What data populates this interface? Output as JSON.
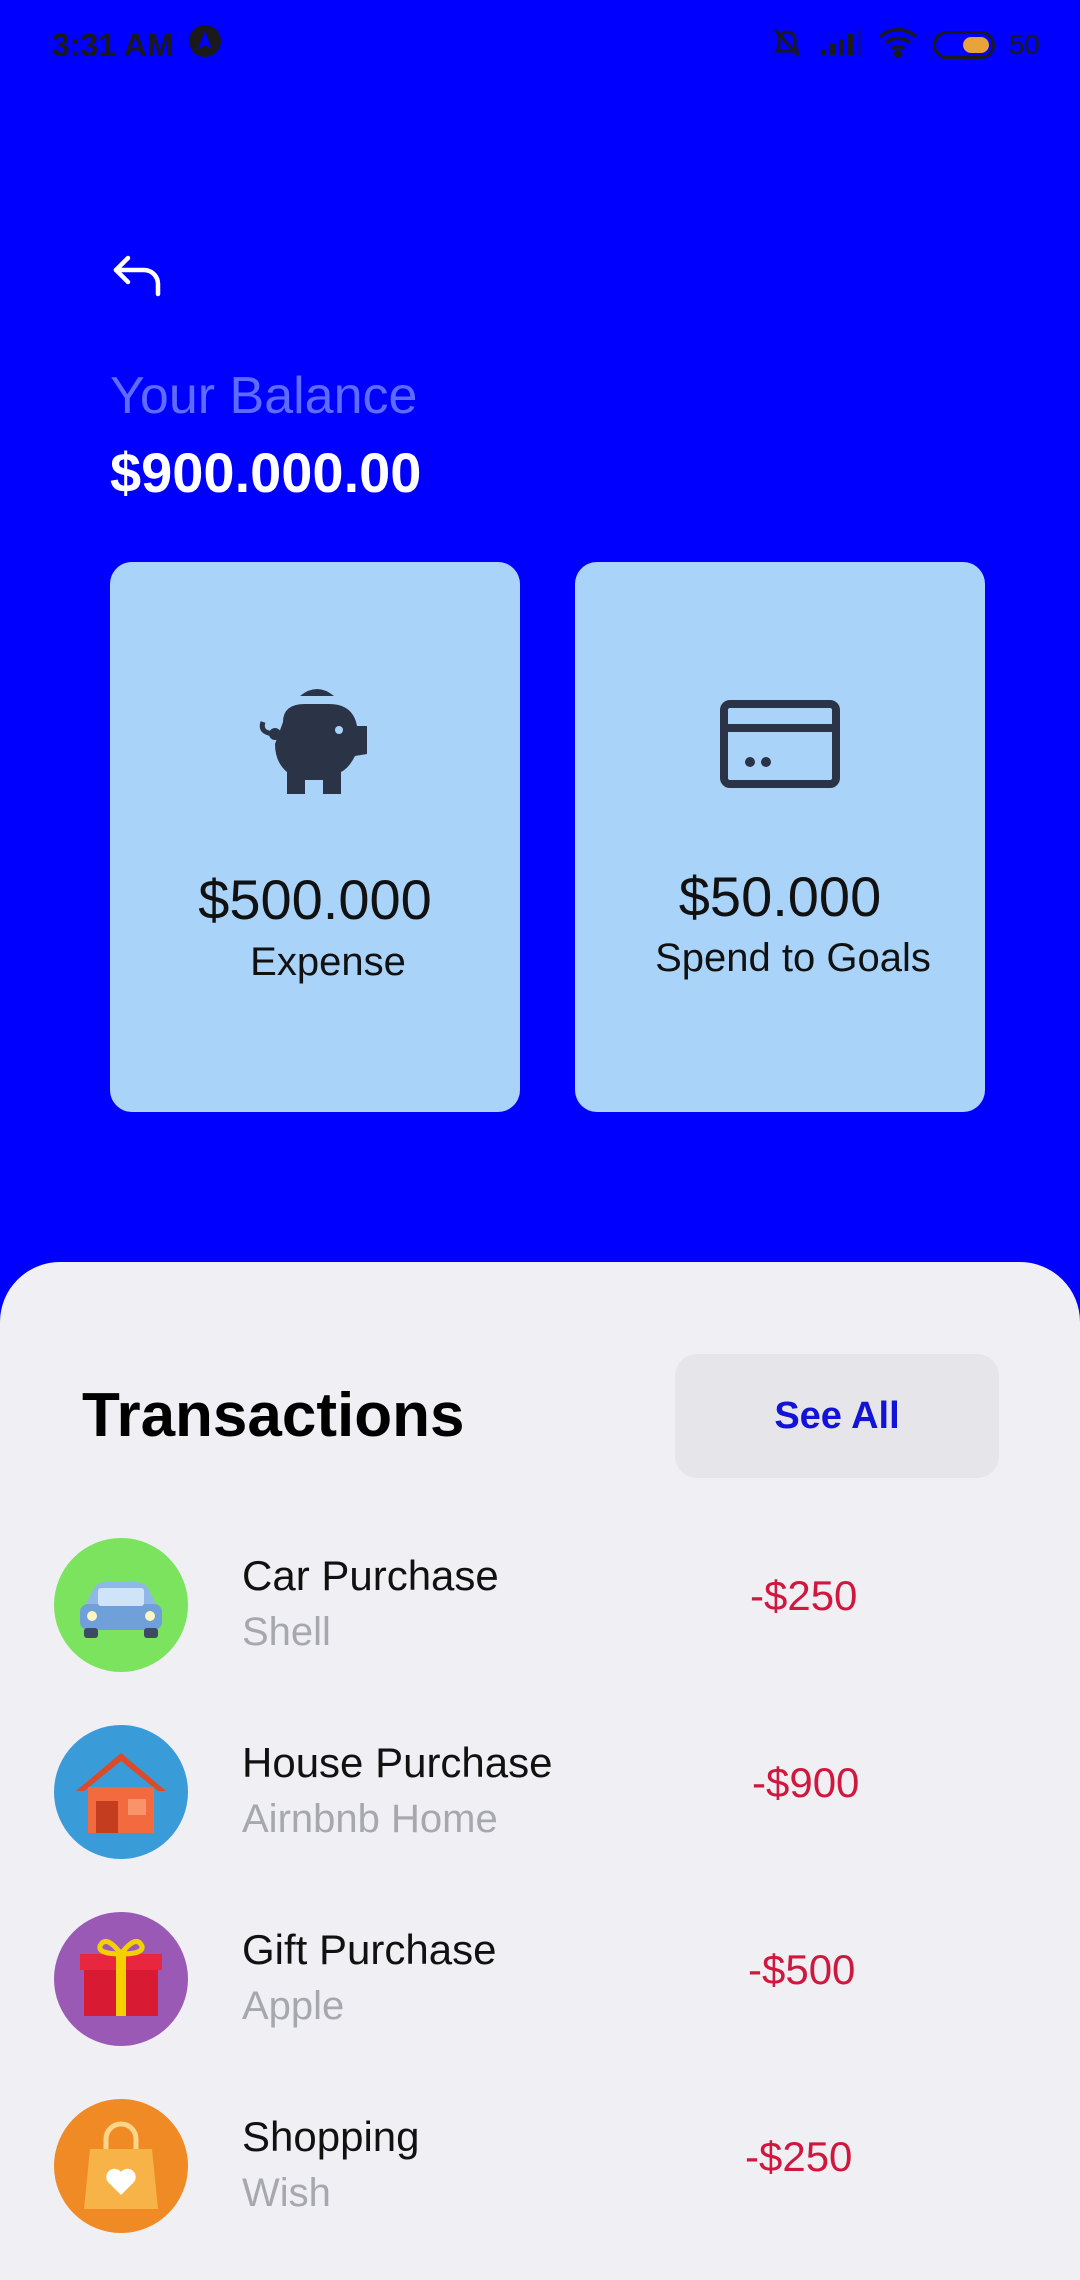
{
  "status_bar": {
    "time": "3:31 AM",
    "battery": "50"
  },
  "header": {
    "balance_label": "Your Balance",
    "balance_value": "$900.000.00"
  },
  "cards": [
    {
      "icon": "piggy-bank-icon",
      "amount": "$500.000",
      "label": "Expense"
    },
    {
      "icon": "credit-card-icon",
      "amount": "$50.000",
      "label": "Spend to Goals"
    }
  ],
  "transactions": {
    "title": "Transactions",
    "see_all_label": "See All",
    "items": [
      {
        "name": "Car Purchase",
        "merchant": "Shell",
        "amount": "-$250",
        "icon": "car-icon",
        "color": "#7BE35E"
      },
      {
        "name": "House Purchase",
        "merchant": "Airnbnb Home",
        "amount": "-$900",
        "icon": "house-icon",
        "color": "#3A9BD9"
      },
      {
        "name": "Gift Purchase",
        "merchant": "Apple",
        "amount": "-$500",
        "icon": "gift-icon",
        "color": "#9B59B6"
      },
      {
        "name": "Shopping",
        "merchant": "Wish",
        "amount": "-$250",
        "icon": "shopping-bag-icon",
        "color": "#F08A24"
      }
    ]
  },
  "colors": {
    "background": "#0000FF",
    "card": "#AAD3FA",
    "sheet": "#F0EFF4",
    "negative_amount": "#D0183F",
    "accent": "#1212D8"
  }
}
